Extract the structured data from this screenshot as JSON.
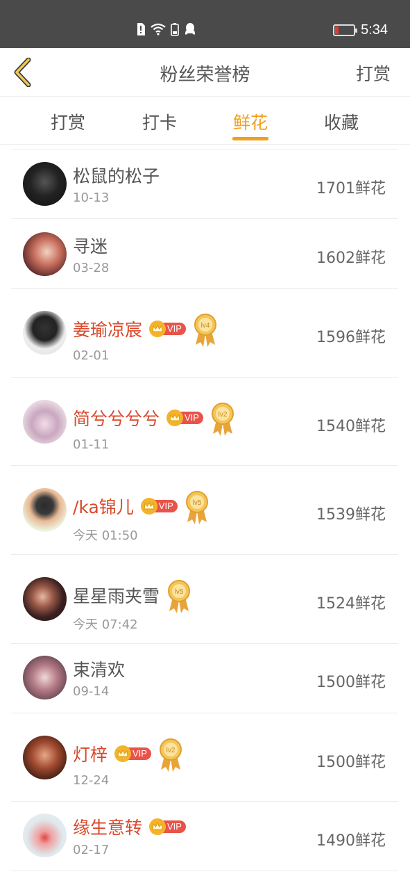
{
  "status_bar": {
    "time": "5:34"
  },
  "header": {
    "title": "粉丝荣誉榜",
    "action": "打赏"
  },
  "tabs": [
    {
      "label": "打赏"
    },
    {
      "label": "打卡"
    },
    {
      "label": "鲜花"
    },
    {
      "label": "收藏"
    }
  ],
  "active_tab": "鲜花",
  "accent_color": "#f0a020",
  "vip_name_color": "#d9482b",
  "rows": [
    {
      "name": "松鼠的松子",
      "date": "10-13",
      "amount": "1701鲜花",
      "vip": false,
      "level": ""
    },
    {
      "name": "寻迷",
      "date": "03-28",
      "amount": "1602鲜花",
      "vip": false,
      "level": ""
    },
    {
      "name": "姜瑜凉宸",
      "date": "02-01",
      "amount": "1596鲜花",
      "vip": true,
      "vip_label": "VIP",
      "level": "lv4"
    },
    {
      "name": "简兮兮兮兮",
      "date": "01-11",
      "amount": "1540鲜花",
      "vip": true,
      "vip_label": "VIP",
      "level": "lv2"
    },
    {
      "name": "/ka锦儿",
      "date": "今天 01:50",
      "amount": "1539鲜花",
      "vip": true,
      "vip_label": "VIP",
      "level": "lv5"
    },
    {
      "name": "星星雨夹雪",
      "date": "今天 07:42",
      "amount": "1524鲜花",
      "vip": false,
      "level": "lv5"
    },
    {
      "name": "束清欢",
      "date": "09-14",
      "amount": "1500鲜花",
      "vip": false,
      "level": ""
    },
    {
      "name": "灯梓",
      "date": "12-24",
      "amount": "1500鲜花",
      "vip": true,
      "vip_label": "VIP",
      "level": "lv2"
    },
    {
      "name": "缘生意转",
      "date": "02-17",
      "amount": "1490鲜花",
      "vip": true,
      "vip_label": "VIP",
      "level": ""
    }
  ]
}
